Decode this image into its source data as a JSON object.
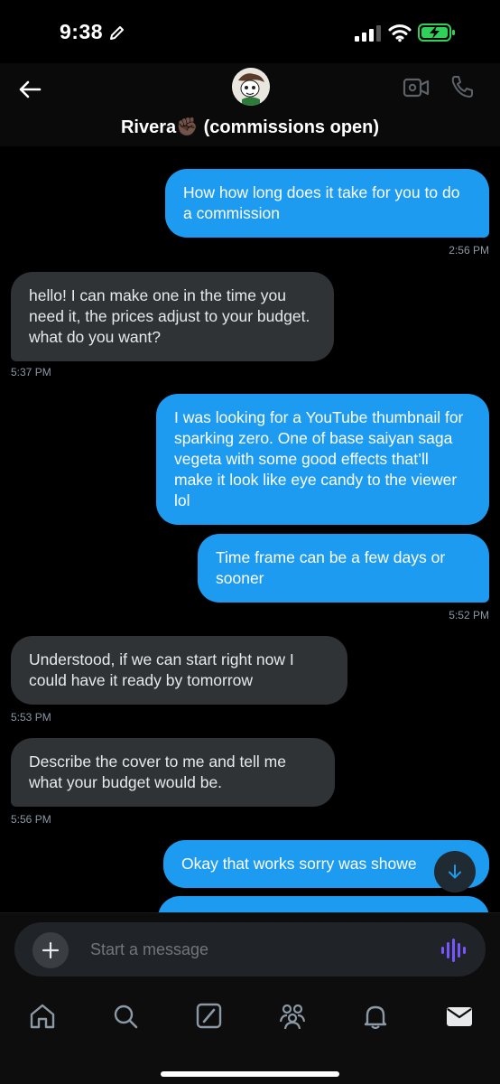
{
  "status_bar": {
    "time": "9:38"
  },
  "header": {
    "contact_name": "Rivera✊🏿 (commissions open)"
  },
  "messages": [
    {
      "dir": "out",
      "text": "How how long does it take for you to do a commission",
      "time": "2:56 PM"
    },
    {
      "dir": "in",
      "text": "hello! I can make one in the time you need it, the prices adjust to your budget. what do you want?",
      "time": "5:37 PM"
    },
    {
      "dir": "out",
      "text": "I was looking for a YouTube thumbnail for sparking zero. One of base saiyan saga vegeta with some good effects that’ll make it look like eye candy to the viewer lol",
      "time": ""
    },
    {
      "dir": "out",
      "text": "Time frame can be a few days or sooner",
      "time": "5:52 PM"
    },
    {
      "dir": "in",
      "text": "Understood, if we can start right now I could have it ready by tomorrow",
      "time": "5:53 PM"
    },
    {
      "dir": "in",
      "text": "Describe the cover to me and tell me what your budget would be.",
      "time": "5:56 PM"
    },
    {
      "dir": "out",
      "text": "Okay that works sorry was showe",
      "time": ""
    }
  ],
  "composer": {
    "placeholder": "Start a message"
  },
  "tabs": [
    "home",
    "search",
    "grok",
    "communities",
    "notifications",
    "messages"
  ],
  "colors": {
    "accent": "#1d9bf0",
    "incoming": "#2f3336",
    "voice": "#7856ff",
    "battery": "#30d158"
  }
}
